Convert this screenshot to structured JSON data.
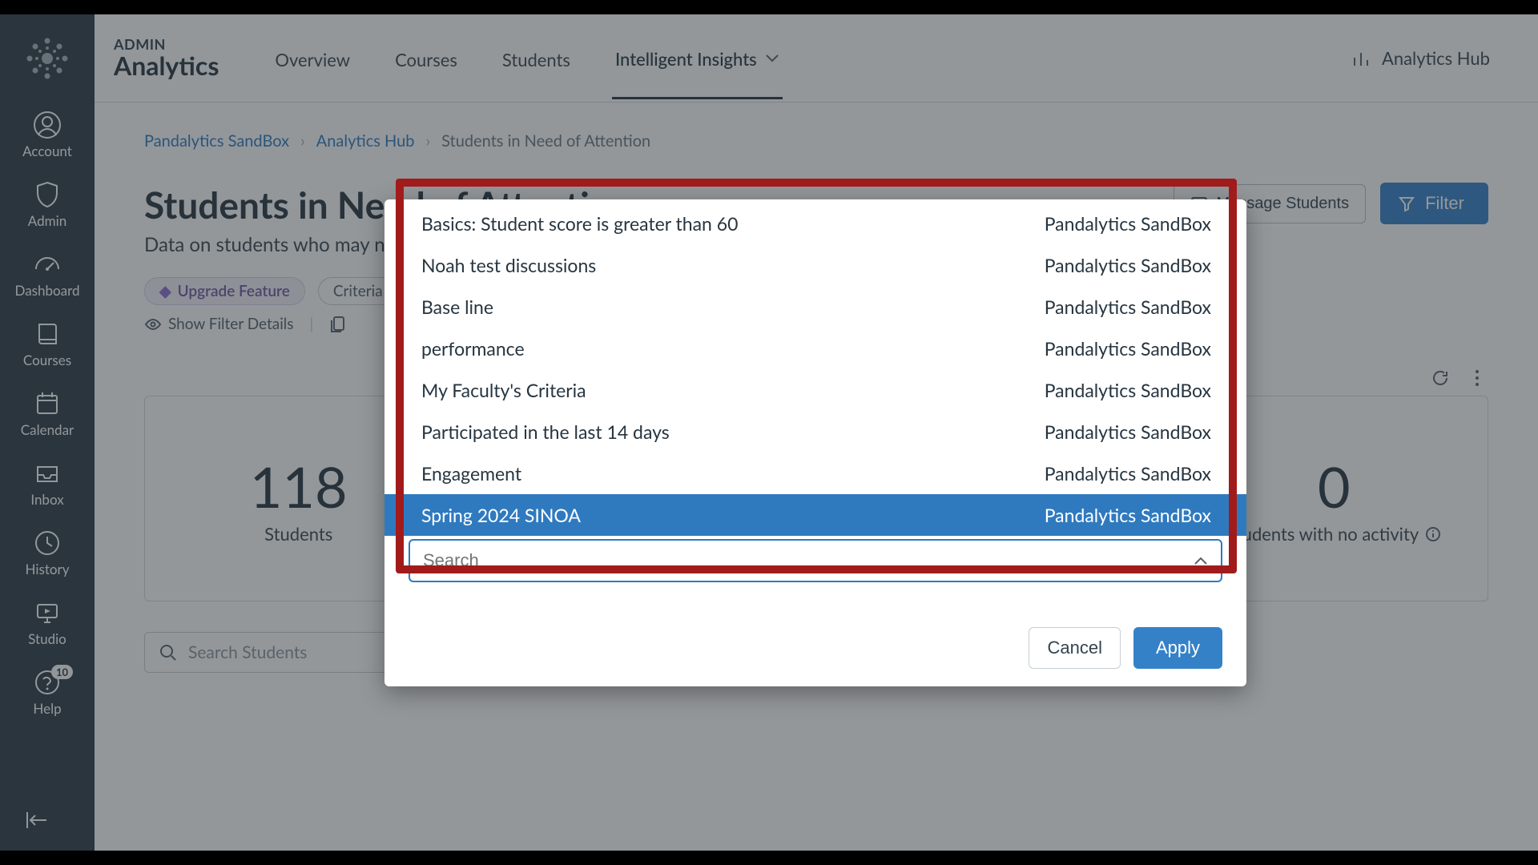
{
  "nav": {
    "items": [
      {
        "label": "Account"
      },
      {
        "label": "Admin"
      },
      {
        "label": "Dashboard"
      },
      {
        "label": "Courses"
      },
      {
        "label": "Calendar"
      },
      {
        "label": "Inbox"
      },
      {
        "label": "History"
      },
      {
        "label": "Studio"
      },
      {
        "label": "Help",
        "badge": "10"
      }
    ]
  },
  "brand": {
    "sub": "ADMIN",
    "main": "Analytics"
  },
  "tabs": {
    "items": [
      "Overview",
      "Courses",
      "Students",
      "Intelligent Insights"
    ],
    "active": 3
  },
  "hub_link": "Analytics Hub",
  "crumbs": [
    "Pandalytics SandBox",
    "Analytics Hub",
    "Students in Need of Attention"
  ],
  "page": {
    "title": "Students in Need of Attention",
    "subtitle": "Data on students who may need additional support"
  },
  "actions": {
    "message": "Message Students",
    "filter": "Filter"
  },
  "pills": {
    "upgrade": "Upgrade Feature",
    "criteria": "Criteria"
  },
  "filter_meta": {
    "show": "Show Filter Details"
  },
  "stats": [
    {
      "num": "118",
      "label": "Students"
    },
    {
      "num": "0",
      "label": "Students with no activity"
    }
  ],
  "search_placeholder": "Search Students",
  "modal": {
    "options": [
      {
        "left": "Basics: Student score is greater than 60",
        "right": "Pandalytics SandBox"
      },
      {
        "left": "Noah test discussions",
        "right": "Pandalytics SandBox"
      },
      {
        "left": "Base line",
        "right": "Pandalytics SandBox"
      },
      {
        "left": "performance",
        "right": "Pandalytics SandBox"
      },
      {
        "left": "My Faculty's Criteria",
        "right": "Pandalytics SandBox"
      },
      {
        "left": "Participated in the last 14 days",
        "right": "Pandalytics SandBox"
      },
      {
        "left": "Engagement",
        "right": "Pandalytics SandBox"
      },
      {
        "left": "Spring 2024 SINOA",
        "right": "Pandalytics SandBox",
        "selected": true
      }
    ],
    "search_placeholder": "Search",
    "cancel": "Cancel",
    "apply": "Apply"
  }
}
